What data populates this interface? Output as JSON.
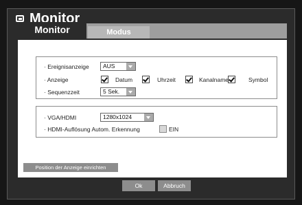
{
  "window": {
    "title": "Monitor"
  },
  "tabs": [
    {
      "label": "Monitor",
      "active": true
    },
    {
      "label": "Modus",
      "active": false
    }
  ],
  "group1": {
    "event_label": "· Ereignisanzeige",
    "event_value": "AUS",
    "display_label": "· Anzeige",
    "checks": [
      {
        "label": "Datum",
        "checked": true
      },
      {
        "label": "Uhrzeit",
        "checked": true
      },
      {
        "label": "Kanalname",
        "checked": true
      },
      {
        "label": "Symbol",
        "checked": true
      }
    ],
    "sequence_label": "· Sequenzzeit",
    "sequence_value": "5 Sek."
  },
  "group2": {
    "vga_label": "· VGA/HDMI",
    "vga_value": "1280x1024",
    "hdmi_label": "· HDMI-Auflösung Autom. Erkennung",
    "hdmi_check_label": "EIN",
    "hdmi_checked": false
  },
  "buttons": {
    "position": "Position der Anzeige einrichten",
    "ok": "Ok",
    "cancel": "Abbruch"
  }
}
